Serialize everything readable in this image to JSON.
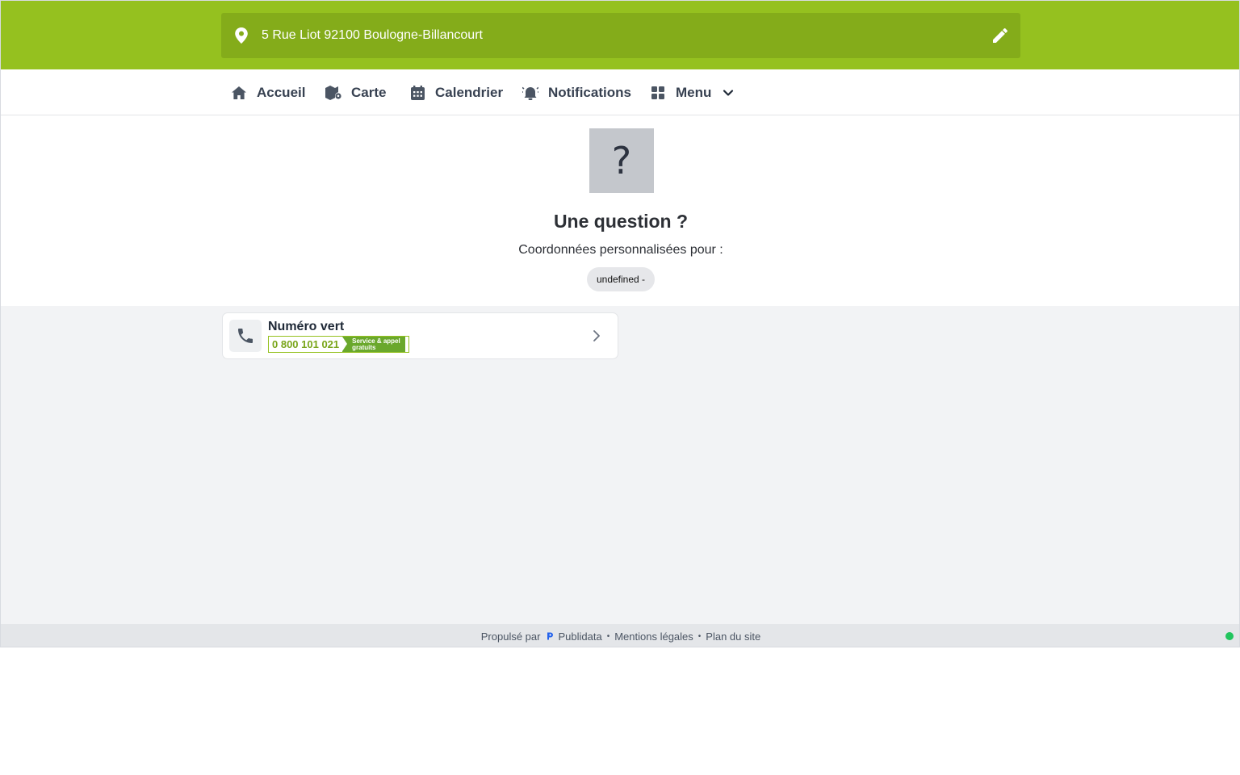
{
  "header": {
    "address": "5 Rue Liot 92100 Boulogne-Billancourt",
    "pin_icon": "map-pin-icon",
    "edit_icon": "pencil-icon",
    "bg_color": "#95c11f",
    "bar_color": "#84ac1a"
  },
  "nav": {
    "items": [
      {
        "label": "Accueil",
        "icon": "home-icon"
      },
      {
        "label": "Carte",
        "icon": "map-icon"
      },
      {
        "label": "Calendrier",
        "icon": "calendar-icon"
      },
      {
        "label": "Notifications",
        "icon": "alarm-bell-icon"
      },
      {
        "label": "Menu",
        "icon": "grid-icon"
      }
    ]
  },
  "hero": {
    "icon_glyph": "?",
    "title": "Une question ?",
    "subtitle": "Coordonnées personnalisées pour :",
    "pill": "undefined -"
  },
  "contact_card": {
    "title": "Numéro vert",
    "number": "0 800 101 021",
    "tag_line1": "Service & appel",
    "tag_line2": "gratuits",
    "icon": "phone-icon",
    "accent": "#79a51a"
  },
  "footer": {
    "powered_by": "Propulsé par",
    "brand": "Publidata",
    "legal": "Mentions légales",
    "sitemap": "Plan du site",
    "status_color": "#22c55e"
  }
}
